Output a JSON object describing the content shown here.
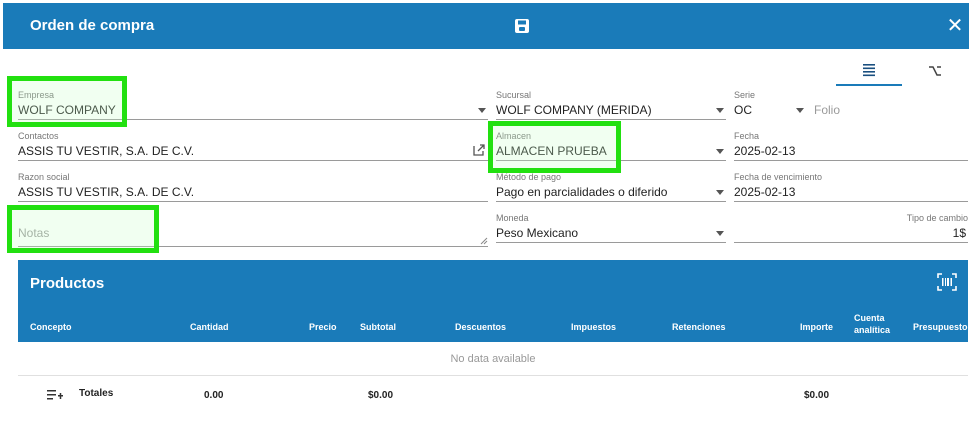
{
  "header": {
    "title": "Orden de compra"
  },
  "form": {
    "empresa": {
      "label": "Empresa",
      "value": "WOLF COMPANY"
    },
    "sucursal": {
      "label": "Sucursal",
      "value": "WOLF COMPANY (MERIDA)"
    },
    "serie": {
      "label": "Serie",
      "value": "OC"
    },
    "folio": {
      "placeholder": "Folio"
    },
    "contactos": {
      "label": "Contactos",
      "value": "ASSIS TU VESTIR, S.A. DE C.V."
    },
    "almacen": {
      "label": "Almacen",
      "value": "ALMACEN PRUEBA"
    },
    "fecha": {
      "label": "Fecha",
      "value": "2025-02-13"
    },
    "razon_social": {
      "label": "Razon social",
      "value": "ASSIS TU VESTIR, S.A. DE C.V."
    },
    "metodo_pago": {
      "label": "Método de pago",
      "value": "Pago en parcialidades o diferido"
    },
    "fecha_vencimiento": {
      "label": "Fecha de vencimiento",
      "value": "2025-02-13"
    },
    "notas": {
      "placeholder": "Notas"
    },
    "moneda": {
      "label": "Moneda",
      "value": "Peso Mexicano"
    },
    "tipo_cambio": {
      "label": "Tipo de cambio",
      "value": "1$"
    }
  },
  "products": {
    "title": "Productos",
    "columns": [
      "Concepto",
      "Cantidad",
      "Precio",
      "Subtotal",
      "Descuentos",
      "Impuestos",
      "Retenciones",
      "Importe",
      "Cuenta analítica",
      "Presupuesto"
    ],
    "empty_text": "No data available",
    "totals": {
      "label": "Totales",
      "cantidad": "0.00",
      "subtotal": "$0.00",
      "importe": "$0.00"
    }
  },
  "colors": {
    "primary": "#1a7bb9",
    "highlight": "#22e010"
  }
}
